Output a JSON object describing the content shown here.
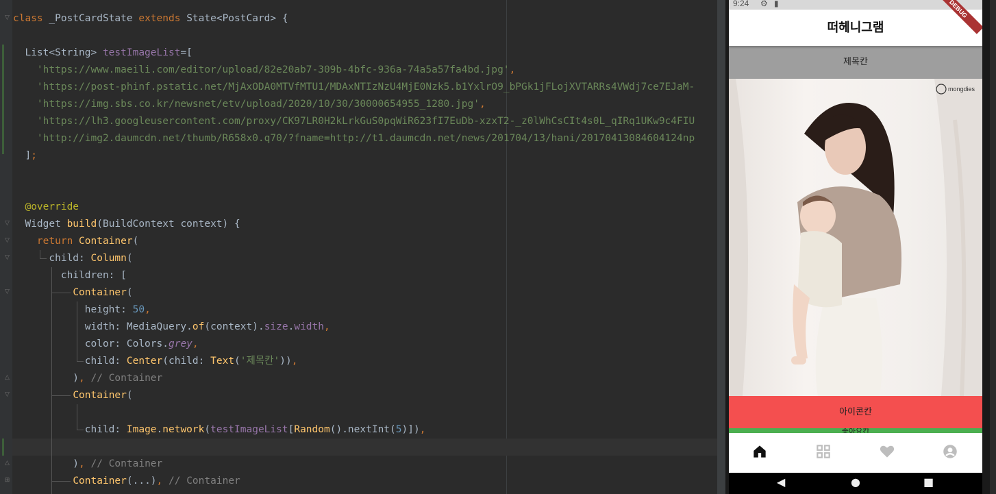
{
  "editor": {
    "lines": [
      {
        "tokens": [
          [
            "kw",
            "class "
          ],
          [
            "plain",
            "_PostCardState "
          ],
          [
            "kw",
            "extends "
          ],
          [
            "plain",
            "State<PostCard> {"
          ]
        ]
      },
      {
        "tokens": []
      },
      {
        "tokens": [
          [
            "plain",
            "  List<String> "
          ],
          [
            "field",
            "testImageList"
          ],
          [
            "plain",
            "=["
          ]
        ]
      },
      {
        "tokens": [
          [
            "plain",
            "    "
          ],
          [
            "str",
            "'https://www.maeili.com/editor/upload/82e20ab7-309b-4bfc-936a-74a5a57fa4bd.jpg'"
          ],
          [
            "kw",
            ","
          ]
        ]
      },
      {
        "tokens": [
          [
            "plain",
            "    "
          ],
          [
            "str",
            "'https://post-phinf.pstatic.net/MjAxODA0MTVfMTU1/MDAxNTIzNzU4MjE0Nzk5.b1YxlrO9_bPGk1jFLojXVTARRs4VWdj7ce7EJaM-"
          ]
        ]
      },
      {
        "tokens": [
          [
            "plain",
            "    "
          ],
          [
            "str",
            "'https://img.sbs.co.kr/newsnet/etv/upload/2020/10/30/30000654955_1280.jpg'"
          ],
          [
            "kw",
            ","
          ]
        ]
      },
      {
        "tokens": [
          [
            "plain",
            "    "
          ],
          [
            "str",
            "'https://lh3.googleusercontent.com/proxy/CK97LR0H2kLrkGuS0pqWiR623fI7EuDb-xzxT2-_z0lWhCsCIt4s0L_qIRq1UKw9c4FIU"
          ]
        ]
      },
      {
        "tokens": [
          [
            "plain",
            "    "
          ],
          [
            "str",
            "'http://img2.daumcdn.net/thumb/R658x0.q70/?fname=http://t1.daumcdn.net/news/201704/13/hani/20170413084604124np"
          ]
        ]
      },
      {
        "tokens": [
          [
            "plain",
            "  ]"
          ],
          [
            "kw",
            ";"
          ]
        ]
      },
      {
        "tokens": []
      },
      {
        "tokens": []
      },
      {
        "tokens": [
          [
            "ann",
            "  @override"
          ]
        ]
      },
      {
        "tokens": [
          [
            "plain",
            "  Widget "
          ],
          [
            "fn",
            "build"
          ],
          [
            "plain",
            "(BuildContext context) {"
          ]
        ]
      },
      {
        "tokens": [
          [
            "plain",
            "    "
          ],
          [
            "kw",
            "return "
          ],
          [
            "fn",
            "Container"
          ],
          [
            "plain",
            "("
          ]
        ]
      },
      {
        "tokens": [
          [
            "plain",
            "      child: "
          ],
          [
            "fn",
            "Column"
          ],
          [
            "plain",
            "("
          ]
        ]
      },
      {
        "tokens": [
          [
            "plain",
            "        children: ["
          ]
        ]
      },
      {
        "tokens": [
          [
            "plain",
            "          "
          ],
          [
            "fn",
            "Container"
          ],
          [
            "plain",
            "("
          ]
        ]
      },
      {
        "tokens": [
          [
            "plain",
            "            height: "
          ],
          [
            "num",
            "50"
          ],
          [
            "kw",
            ","
          ]
        ]
      },
      {
        "tokens": [
          [
            "plain",
            "            width: MediaQuery."
          ],
          [
            "fn",
            "of"
          ],
          [
            "plain",
            "(context)."
          ],
          [
            "field",
            "size"
          ],
          [
            "plain",
            "."
          ],
          [
            "field",
            "width"
          ],
          [
            "kw",
            ","
          ]
        ]
      },
      {
        "tokens": [
          [
            "plain",
            "            color: Colors."
          ],
          [
            "ital",
            "grey"
          ],
          [
            "kw",
            ","
          ]
        ]
      },
      {
        "tokens": [
          [
            "plain",
            "            child: "
          ],
          [
            "fn",
            "Center"
          ],
          [
            "plain",
            "(child: "
          ],
          [
            "fn",
            "Text"
          ],
          [
            "plain",
            "("
          ],
          [
            "str",
            "'제목칸'"
          ],
          [
            "plain",
            "))"
          ],
          [
            "kw",
            ","
          ]
        ]
      },
      {
        "tokens": [
          [
            "plain",
            "          )"
          ],
          [
            "kw",
            ", "
          ],
          [
            "cm",
            "// Container"
          ]
        ]
      },
      {
        "tokens": [
          [
            "plain",
            "          "
          ],
          [
            "fn",
            "Container"
          ],
          [
            "plain",
            "("
          ]
        ]
      },
      {
        "tokens": []
      },
      {
        "tokens": [
          [
            "plain",
            "            child: "
          ],
          [
            "fn",
            "Image"
          ],
          [
            "plain",
            "."
          ],
          [
            "fn",
            "network"
          ],
          [
            "plain",
            "("
          ],
          [
            "field",
            "testImageList"
          ],
          [
            "plain",
            "["
          ],
          [
            "fn",
            "Random"
          ],
          [
            "plain",
            "().nextInt("
          ],
          [
            "num",
            "5"
          ],
          [
            "plain",
            ")])"
          ],
          [
            "kw",
            ","
          ]
        ]
      },
      {
        "tokens": []
      },
      {
        "tokens": [
          [
            "plain",
            "          )"
          ],
          [
            "kw",
            ", "
          ],
          [
            "cm",
            "// Container"
          ]
        ]
      },
      {
        "tokens": [
          [
            "plain",
            "          "
          ],
          [
            "fn",
            "Container"
          ],
          [
            "plain",
            "(...)"
          ],
          [
            "kw",
            ", "
          ],
          [
            "cm",
            "// Container"
          ]
        ]
      }
    ]
  },
  "phone": {
    "status_time": "9:24",
    "status_icons": [
      "gear-icon",
      "sd-card-icon"
    ],
    "debug_banner": "DEBUG",
    "app_title": "떠헤니그램",
    "title_box_text": "제목칸",
    "image_watermark": "mongdies",
    "icon_box_text": "아이콘칸",
    "green_box_text": "좋아요칸",
    "bottom_nav": [
      "home-icon",
      "grid-icon",
      "heart-icon",
      "account-icon"
    ],
    "system_nav": [
      "back-icon",
      "home-circle-icon",
      "recents-icon"
    ],
    "colors": {
      "title_box": "#9e9e9e",
      "icon_box": "#f44f4f",
      "green_box": "#4caf50"
    }
  }
}
